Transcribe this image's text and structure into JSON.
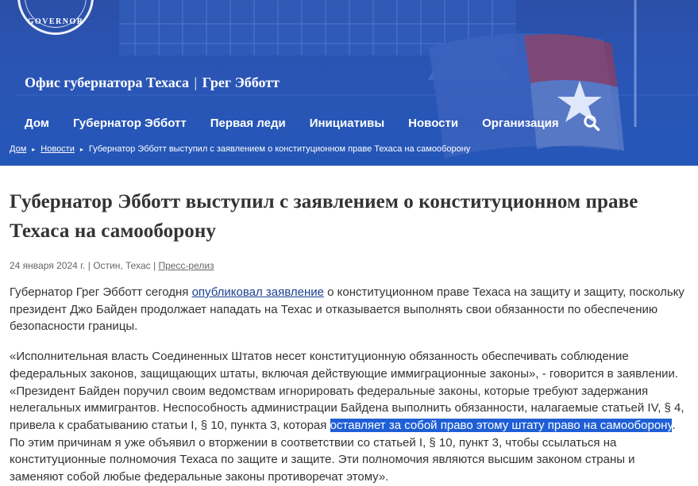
{
  "header": {
    "seal_text": "GOVERNOR",
    "site_title_office": "Офис губернатора Техаса",
    "site_title_sep": "|",
    "site_title_name": "Грег Эбботт",
    "nav": [
      "Дом",
      "Губернатор Эбботт",
      "Первая леди",
      "Инициативы",
      "Новости",
      "Организация"
    ],
    "search_icon": "search-icon"
  },
  "breadcrumb": {
    "home": "Дом",
    "news": "Новости",
    "current": "Губернатор Эбботт выступил с заявлением о конституционном праве Техаса на самооборону",
    "separator": "▸"
  },
  "article": {
    "title": "Губернатор Эбботт выступил с заявлением о конституционном праве Техаса на самооборону",
    "date": "24 января 2024 г.",
    "location": "Остин, Техас",
    "category": "Пресс-релиз",
    "meta_sep": "|",
    "p1_before": "Губернатор Грег Эбботт сегодня ",
    "p1_link": "опубликовал заявление",
    "p1_after": " о конституционном праве Техаса на защиту и защиту, поскольку президент Джо Байден продолжает нападать на Техас и отказывается выполнять свои обязанности по обеспечению безопасности границы.",
    "p2_before": "«Исполнительная власть Соединенных Штатов несет конституционную обязанность обеспечивать соблюдение федеральных законов, защищающих штаты, включая действующие иммиграционные законы», - говорится в заявлении. «Президент Байден поручил своим ведомствам игнорировать федеральные законы, которые требуют задержания нелегальных иммигрантов. Неспособность администрации Байдена выполнить обязанности, налагаемые статьей IV, § 4, привела к срабатыванию статьи I, § 10, пункта 3, которая ",
    "p2_highlight": "оставляет за собой право этому штату право на самооборону",
    "p2_after": ". По этим причинам я уже объявил о вторжении в соответствии со статьей I, § 10, пункт 3, чтобы ссылаться на конституционные полномочия Техаса по защите и защите. Эти полномочия являются высшим законом страны и заменяют собой любые федеральные законы противоречат этому»."
  },
  "colors": {
    "header_blue": "#2a55b5",
    "link": "#1b3f8f",
    "highlight": "#1f5fd6",
    "flag_red": "#b5353f"
  }
}
